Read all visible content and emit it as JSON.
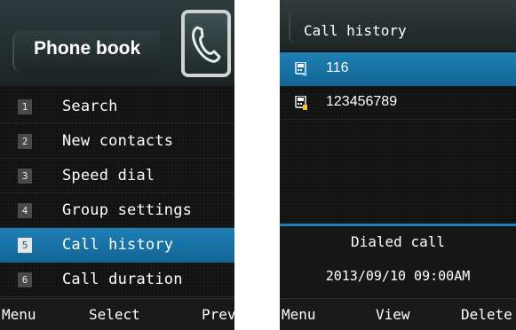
{
  "phonebook": {
    "title": "Phone book",
    "menu": [
      {
        "num": "1",
        "label": "Search"
      },
      {
        "num": "2",
        "label": "New contacts"
      },
      {
        "num": "3",
        "label": "Speed dial"
      },
      {
        "num": "4",
        "label": "Group settings"
      },
      {
        "num": "5",
        "label": "Call history",
        "selected": true
      },
      {
        "num": "6",
        "label": "Call duration"
      }
    ],
    "softkeys": {
      "left": "Menu",
      "center": "Select",
      "right": "Prev"
    }
  },
  "call_history": {
    "title": "Call history",
    "entries": [
      {
        "number": "116",
        "icon": "dialed-call-icon",
        "selected": true
      },
      {
        "number": "123456789",
        "icon": "received-call-icon"
      }
    ],
    "detail": {
      "type": "Dialed call",
      "datetime": "2013/09/10 09:00AM"
    },
    "softkeys": {
      "left": "Menu",
      "center": "View",
      "right": "Delete"
    }
  },
  "colors": {
    "selection": "#1a75a8",
    "background": "#121212",
    "text": "#ffffff"
  }
}
